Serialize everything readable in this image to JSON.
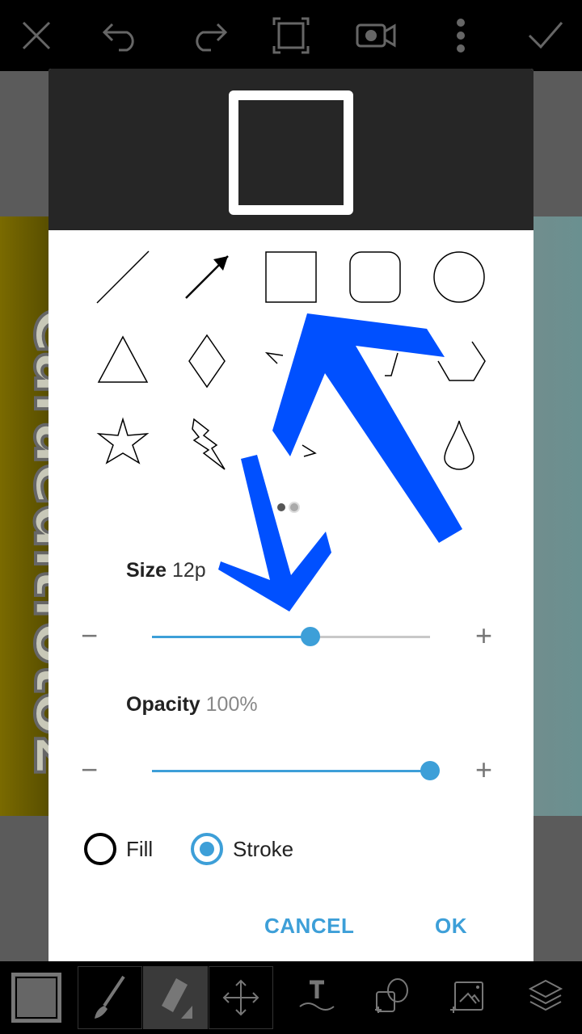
{
  "top_toolbar": {
    "icons": [
      "close-icon",
      "undo-icon",
      "redo-icon",
      "crop-frame-icon",
      "video-record-icon",
      "more-vert-icon",
      "check-icon"
    ]
  },
  "watermark": "Caraeditfoto2",
  "shape_dialog": {
    "shapes": [
      "line",
      "arrow",
      "square",
      "rounded-square",
      "circle",
      "triangle",
      "diamond",
      "pentagon",
      "rectangle",
      "hexagon",
      "star",
      "lightning",
      "speech-bubble",
      "blob",
      "drop"
    ],
    "page_indicator": {
      "pages": 2,
      "current": 1
    },
    "size": {
      "label": "Size",
      "value": "12p",
      "level_percent": 57
    },
    "opacity": {
      "label": "Opacity",
      "value": "100%",
      "level_percent": 100
    },
    "fill_label": "Fill",
    "stroke_label": "Stroke",
    "selected_mode": "stroke",
    "minus": "−",
    "plus": "+",
    "cancel_label": "CANCEL",
    "ok_label": "OK"
  },
  "bottom_toolbar": {
    "icons": [
      "color-swatch-icon",
      "brush-icon",
      "eraser-icon",
      "move-icon",
      "text-icon",
      "add-shape-icon",
      "add-photo-icon",
      "layers-icon"
    ],
    "selected": "eraser-icon"
  },
  "colors": {
    "accent": "#3d9fd8",
    "annotation_arrow": "#0050ff",
    "preview_bg": "#262626"
  }
}
